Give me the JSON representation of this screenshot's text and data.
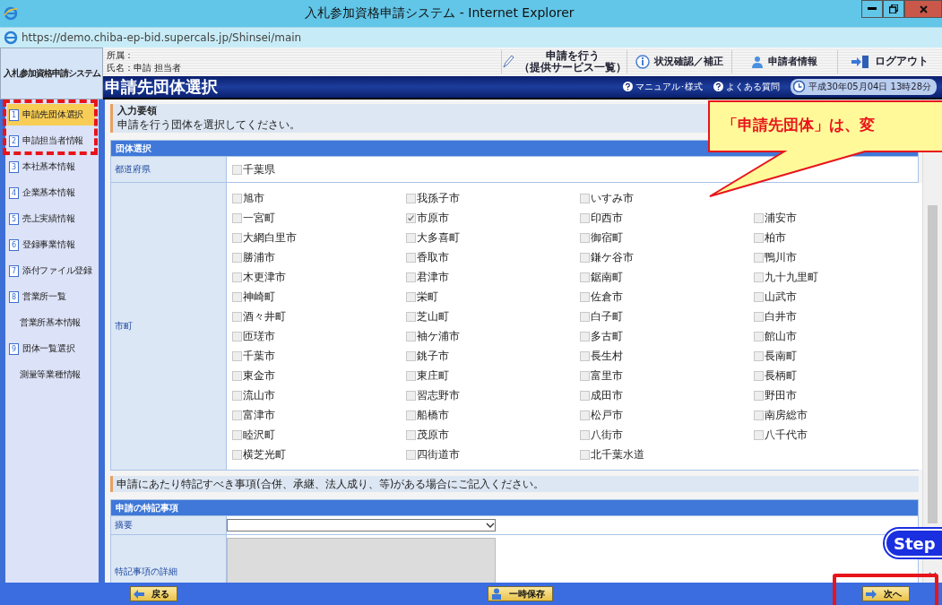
{
  "window": {
    "title": "入札参加資格申請システム - Internet Explorer",
    "address": "https://demo.chiba-ep-bid.supercals.jp/Shinsei/main"
  },
  "header": {
    "system_name": "入札参加資格申請システム",
    "affiliation": "所属：",
    "name": "氏名：申請 担当者",
    "nav": [
      {
        "lines": [
          "申請を行う",
          "（提供サービス一覧）"
        ]
      },
      {
        "lines": [
          "状況確認／補正"
        ]
      },
      {
        "lines": [
          "申請者情報"
        ]
      },
      {
        "lines": [
          "ログアウト"
        ]
      }
    ],
    "page_title": "申請先団体選択",
    "links": [
      "マニュアル･様式",
      "よくある質問"
    ],
    "datetime": "平成30年05月04日 13時28分"
  },
  "sidebar": {
    "items": [
      {
        "number": "1",
        "label": "申請先団体選択",
        "selected": true
      },
      {
        "number": "2",
        "label": "申請担当者情報",
        "selected": false
      },
      {
        "number": "3",
        "label": "本社基本情報",
        "selected": false
      },
      {
        "number": "4",
        "label": "企業基本情報",
        "selected": false
      },
      {
        "number": "5",
        "label": "売上実績情報",
        "selected": false
      },
      {
        "number": "6",
        "label": "登録事業情報",
        "selected": false
      },
      {
        "number": "7",
        "label": "添付ファイル登録",
        "selected": false
      },
      {
        "number": "8",
        "label": "営業所一覧",
        "selected": false,
        "children": [
          {
            "label": "営業所基本情報",
            "selected": false
          }
        ]
      },
      {
        "number": "9",
        "label": "団体一覧選択",
        "selected": false,
        "children": [
          {
            "label": "測量等業種情報",
            "selected": false
          }
        ]
      }
    ]
  },
  "instructions": {
    "heading": "入力要領",
    "text": "申請を行う団体を選択してください。"
  },
  "group_select": {
    "title": "団体選択",
    "prefecture_label": "都道府県",
    "prefecture": {
      "label": "千葉県",
      "checked": false
    },
    "municipality_label": "市町",
    "rows": [
      [
        {
          "label": "旭市",
          "checked": false
        },
        {
          "label": "我孫子市",
          "checked": false
        },
        {
          "label": "いすみ市",
          "checked": false
        }
      ],
      [
        {
          "label": "一宮町",
          "checked": false
        },
        {
          "label": "市原市",
          "checked": true
        },
        {
          "label": "印西市",
          "checked": false
        },
        {
          "label": "浦安市",
          "checked": false
        }
      ],
      [
        {
          "label": "大網白里市",
          "checked": false
        },
        {
          "label": "大多喜町",
          "checked": false
        },
        {
          "label": "御宿町",
          "checked": false
        },
        {
          "label": "柏市",
          "checked": false
        }
      ],
      [
        {
          "label": "勝浦市",
          "checked": false
        },
        {
          "label": "香取市",
          "checked": false
        },
        {
          "label": "鎌ケ谷市",
          "checked": false
        },
        {
          "label": "鴨川市",
          "checked": false
        }
      ],
      [
        {
          "label": "木更津市",
          "checked": false
        },
        {
          "label": "君津市",
          "checked": false
        },
        {
          "label": "鋸南町",
          "checked": false
        },
        {
          "label": "九十九里町",
          "checked": false
        }
      ],
      [
        {
          "label": "神崎町",
          "checked": false
        },
        {
          "label": "栄町",
          "checked": false
        },
        {
          "label": "佐倉市",
          "checked": false
        },
        {
          "label": "山武市",
          "checked": false
        }
      ],
      [
        {
          "label": "酒々井町",
          "checked": false
        },
        {
          "label": "芝山町",
          "checked": false
        },
        {
          "label": "白子町",
          "checked": false
        },
        {
          "label": "白井市",
          "checked": false
        }
      ],
      [
        {
          "label": "匝瑳市",
          "checked": false
        },
        {
          "label": "袖ケ浦市",
          "checked": false
        },
        {
          "label": "多古町",
          "checked": false
        },
        {
          "label": "館山市",
          "checked": false
        }
      ],
      [
        {
          "label": "千葉市",
          "checked": false
        },
        {
          "label": "銚子市",
          "checked": false
        },
        {
          "label": "長生村",
          "checked": false
        },
        {
          "label": "長南町",
          "checked": false
        }
      ],
      [
        {
          "label": "東金市",
          "checked": false
        },
        {
          "label": "東庄町",
          "checked": false
        },
        {
          "label": "富里市",
          "checked": false
        },
        {
          "label": "長柄町",
          "checked": false
        }
      ],
      [
        {
          "label": "流山市",
          "checked": false
        },
        {
          "label": "習志野市",
          "checked": false
        },
        {
          "label": "成田市",
          "checked": false
        },
        {
          "label": "野田市",
          "checked": false
        }
      ],
      [
        {
          "label": "富津市",
          "checked": false
        },
        {
          "label": "船橋市",
          "checked": false
        },
        {
          "label": "松戸市",
          "checked": false
        },
        {
          "label": "南房総市",
          "checked": false
        }
      ],
      [
        {
          "label": "睦沢町",
          "checked": false
        },
        {
          "label": "茂原市",
          "checked": false
        },
        {
          "label": "八街市",
          "checked": false
        },
        {
          "label": "八千代市",
          "checked": false
        }
      ],
      [
        {
          "label": "横芝光町",
          "checked": false
        },
        {
          "label": "四街道市",
          "checked": false
        },
        {
          "label": "北千葉水道",
          "checked": false
        }
      ]
    ]
  },
  "note": "申請にあたり特記すべき事項(合併、承継、法人成り、等)がある場合にご記入ください。",
  "special_notes": {
    "title": "申請の特記事項",
    "summary_label": "摘要",
    "detail_label": "特記事項の詳細",
    "detail_disabled": true
  },
  "footer": {
    "buttons": [
      {
        "label": "戻る"
      },
      {
        "label": "一時保存"
      },
      {
        "label": "次へ"
      }
    ]
  },
  "annotations": {
    "callout": "「申請先団体」は、変",
    "step_badge": "Step"
  }
}
